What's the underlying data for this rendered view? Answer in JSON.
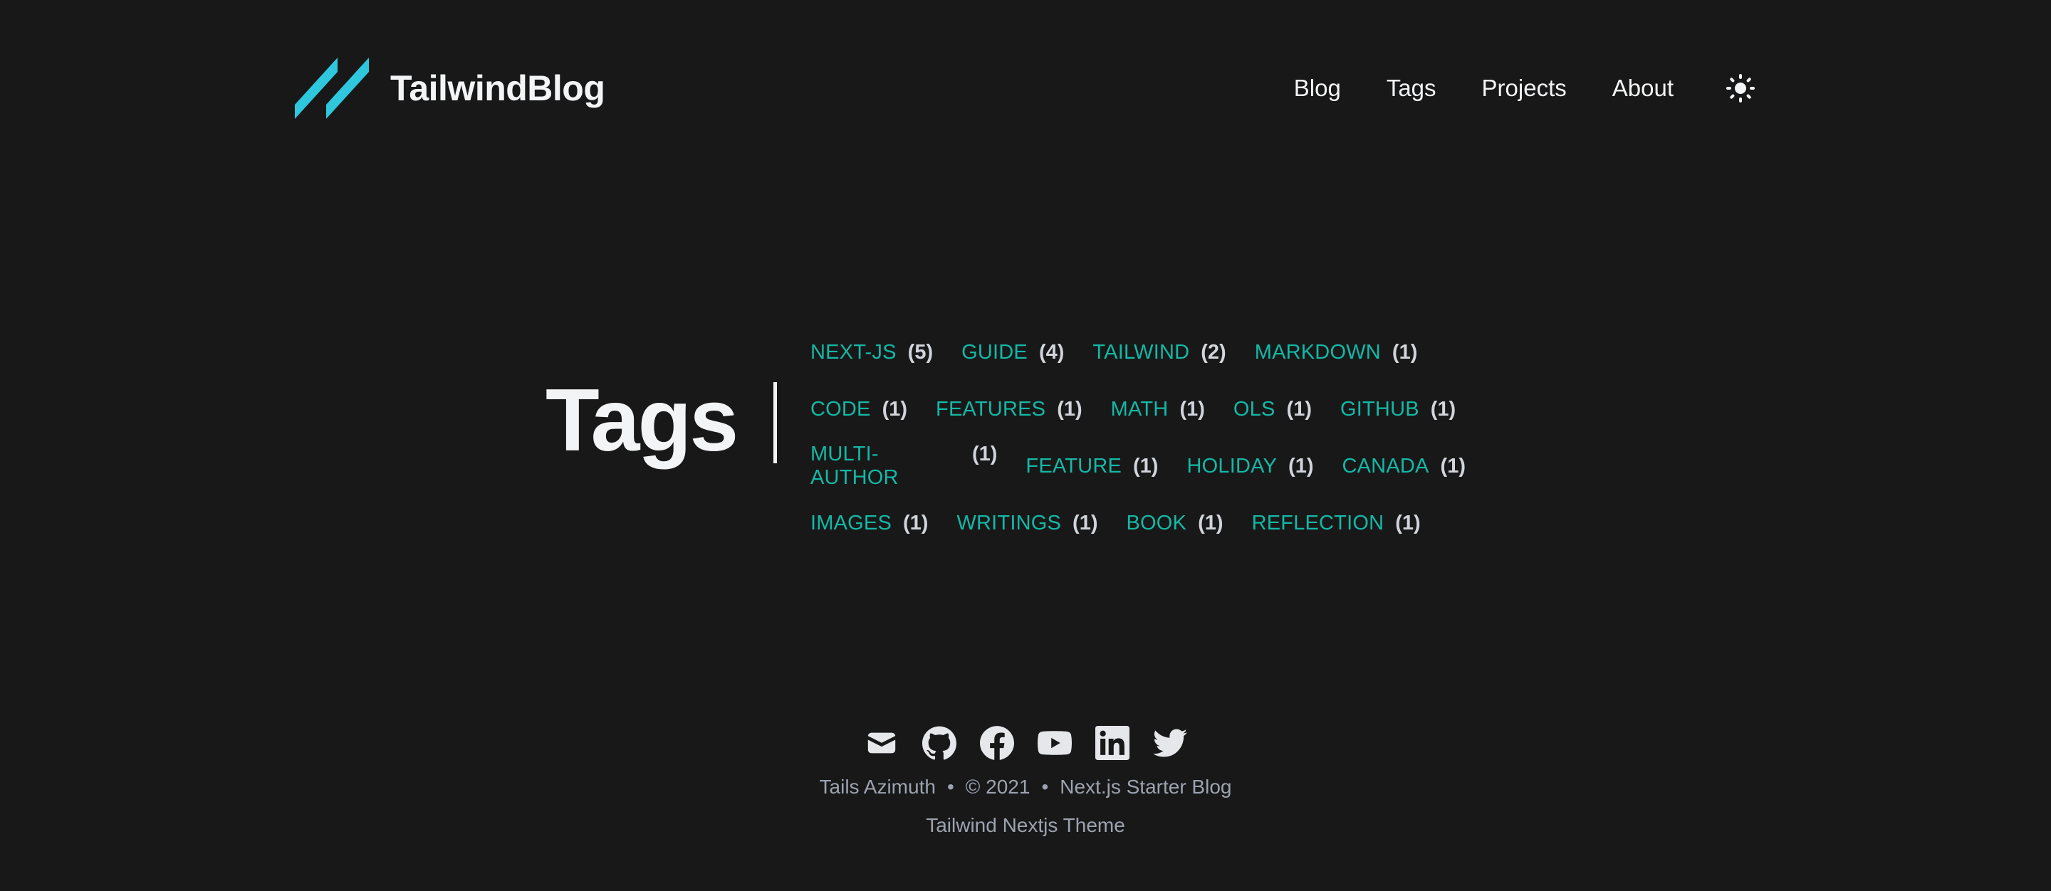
{
  "header": {
    "brand_name": "TailwindBlog",
    "nav": [
      "Blog",
      "Tags",
      "Projects",
      "About"
    ]
  },
  "main": {
    "title": "Tags",
    "tag_rows": [
      [
        {
          "label": "NEXT-JS",
          "count": "(5)"
        },
        {
          "label": "GUIDE",
          "count": "(4)"
        },
        {
          "label": "TAILWIND",
          "count": "(2)"
        },
        {
          "label": "MARKDOWN",
          "count": "(1)"
        }
      ],
      [
        {
          "label": "CODE",
          "count": "(1)"
        },
        {
          "label": "FEATURES",
          "count": "(1)"
        },
        {
          "label": "MATH",
          "count": "(1)"
        },
        {
          "label": "OLS",
          "count": "(1)"
        },
        {
          "label": "GITHUB",
          "count": "(1)"
        }
      ],
      [
        {
          "label": "MULTI-AUTHOR",
          "count": "(1)"
        },
        {
          "label": "FEATURE",
          "count": "(1)"
        },
        {
          "label": "HOLIDAY",
          "count": "(1)"
        },
        {
          "label": "CANADA",
          "count": "(1)"
        }
      ],
      [
        {
          "label": "IMAGES",
          "count": "(1)"
        },
        {
          "label": "WRITINGS",
          "count": "(1)"
        },
        {
          "label": "BOOK",
          "count": "(1)"
        },
        {
          "label": "REFLECTION",
          "count": "(1)"
        }
      ]
    ]
  },
  "footer": {
    "social_icons": [
      "mail-icon",
      "github-icon",
      "facebook-icon",
      "youtube-icon",
      "linkedin-icon",
      "twitter-icon"
    ],
    "author": "Tails Azimuth",
    "separator": "•",
    "copyright": "© 2021",
    "site_title": "Next.js Starter Blog",
    "theme_credit": "Tailwind Nextjs Theme"
  },
  "colors": {
    "background": "#181818",
    "accent": "#14b8a6",
    "logo": "#2ec7de",
    "text": "#f3f4f6",
    "muted": "#9ca3af"
  }
}
